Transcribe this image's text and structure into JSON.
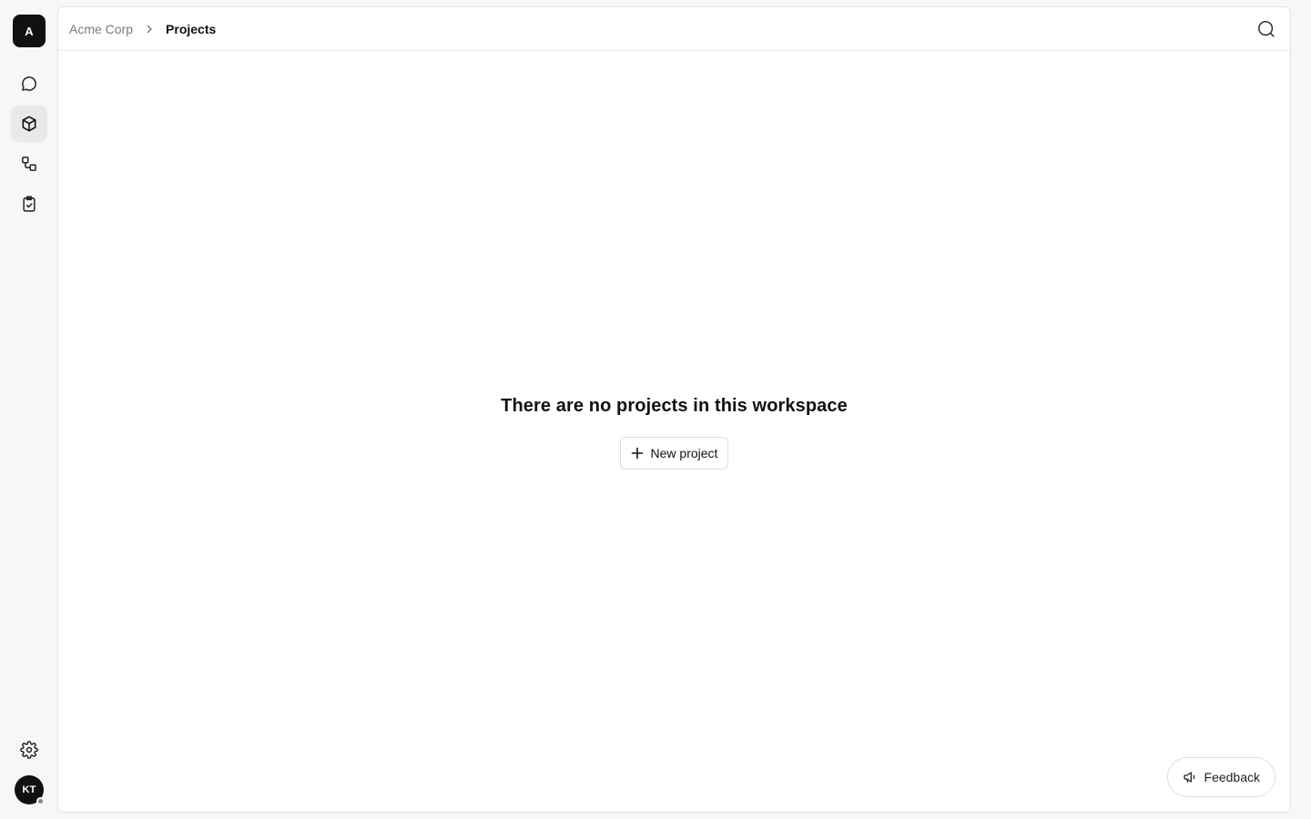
{
  "workspace": {
    "initial": "A",
    "name": "Acme Corp"
  },
  "sidebar": {
    "items": [
      {
        "id": "chat",
        "icon": "chat-bubble-icon",
        "active": false
      },
      {
        "id": "projects",
        "icon": "cube-icon",
        "active": true
      },
      {
        "id": "flows",
        "icon": "workflow-icon",
        "active": false
      },
      {
        "id": "tasks",
        "icon": "clipboard-check-icon",
        "active": false
      }
    ],
    "settings_icon": "gear-icon"
  },
  "user": {
    "initials": "KT",
    "status": "offline"
  },
  "breadcrumb": {
    "root": "Acme Corp",
    "current": "Projects"
  },
  "header": {
    "search_icon": "search-icon"
  },
  "empty_state": {
    "title": "There are no projects in this workspace",
    "button_label": "New project"
  },
  "feedback": {
    "label": "Feedback"
  },
  "colors": {
    "accent": "#111111",
    "active_bg": "#e9e9e9",
    "border": "#e3e3e3",
    "page_bg": "#f7f7f7"
  }
}
